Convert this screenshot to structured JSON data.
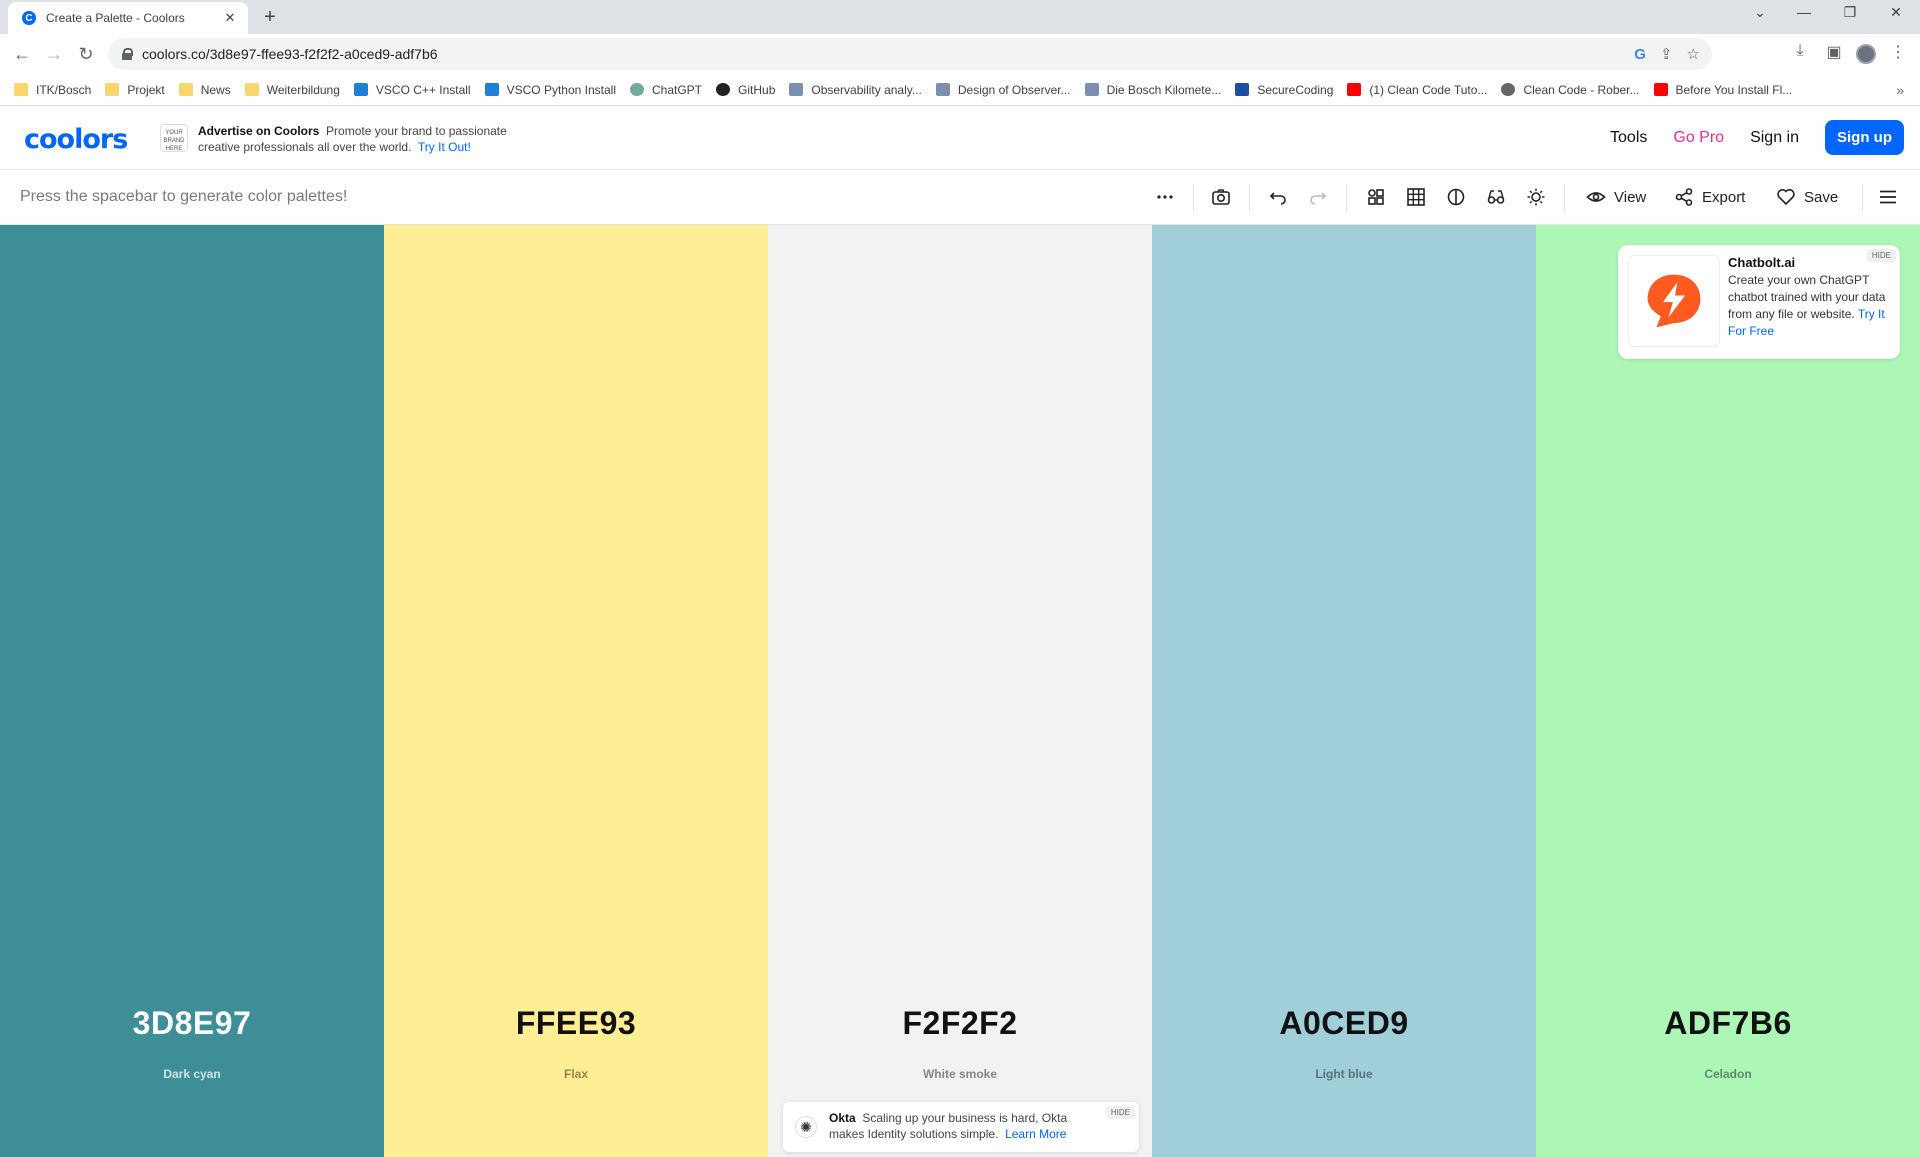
{
  "browser": {
    "tab_title": "Create a Palette - Coolors",
    "url": "coolors.co/3d8e97-ffee93-f2f2f2-a0ced9-adf7b6",
    "bookmarks": [
      {
        "label": "ITK/Bosch",
        "icon": "folder-icon"
      },
      {
        "label": "Projekt",
        "icon": "folder-icon"
      },
      {
        "label": "News",
        "icon": "folder-icon"
      },
      {
        "label": "Weiterbildung",
        "icon": "folder-icon"
      },
      {
        "label": "VSCO C++ Install",
        "icon": "vscode-icon"
      },
      {
        "label": "VSCO Python Install",
        "icon": "vscode-icon"
      },
      {
        "label": "ChatGPT",
        "icon": "chatgpt-icon"
      },
      {
        "label": "GitHub",
        "icon": "github-icon"
      },
      {
        "label": "Observability analy...",
        "icon": "page-icon"
      },
      {
        "label": "Design of Observer...",
        "icon": "page-icon"
      },
      {
        "label": "Die Bosch Kilomete...",
        "icon": "page-icon"
      },
      {
        "label": "SecureCoding",
        "icon": "sf-icon"
      },
      {
        "label": "(1) Clean Code Tuto...",
        "icon": "youtube-icon"
      },
      {
        "label": "Clean Code - Rober...",
        "icon": "globe-icon"
      },
      {
        "label": "Before You Install Fl...",
        "icon": "youtube-icon"
      }
    ]
  },
  "header": {
    "logo": "coolors",
    "ad_badge": "YOUR BRAND HERE",
    "ad_title": "Advertise on Coolors",
    "ad_body": "Promote your brand to passionate creative professionals all over the world.",
    "ad_link": "Try It Out!",
    "tools": "Tools",
    "gopro": "Go Pro",
    "signin": "Sign in",
    "signup": "Sign up"
  },
  "toolbar": {
    "hint": "Press the spacebar to generate color palettes!",
    "view": "View",
    "export": "Export",
    "save": "Save"
  },
  "palette": [
    {
      "hex": "3D8E97",
      "name": "Dark cyan",
      "color": "#3d8e97",
      "text_color": "#ffffff",
      "sub_color": "rgba(255,255,255,0.75)"
    },
    {
      "hex": "FFEE93",
      "name": "Flax",
      "color": "#ffee93",
      "text_color": "#111111",
      "sub_color": "rgba(0,0,0,0.45)"
    },
    {
      "hex": "F2F2F2",
      "name": "White smoke",
      "color": "#f2f2f2",
      "text_color": "#111111",
      "sub_color": "rgba(0,0,0,0.45)"
    },
    {
      "hex": "A0CED9",
      "name": "Light blue",
      "color": "#a0ced9",
      "text_color": "#111111",
      "sub_color": "rgba(0,0,0,0.45)"
    },
    {
      "hex": "ADF7B6",
      "name": "Celadon",
      "color": "#adf7b6",
      "text_color": "#111111",
      "sub_color": "rgba(0,0,0,0.45)"
    }
  ],
  "ads": {
    "chatbolt": {
      "title": "Chatbolt.ai",
      "body": "Create your own ChatGPT chatbot trained with your data from any file or website.",
      "link": "Try It For Free",
      "hide": "HIDE"
    },
    "okta": {
      "title": "Okta",
      "body": "Scaling up your business is hard, Okta makes Identity solutions simple.",
      "link": "Learn More",
      "hide": "HIDE"
    }
  }
}
